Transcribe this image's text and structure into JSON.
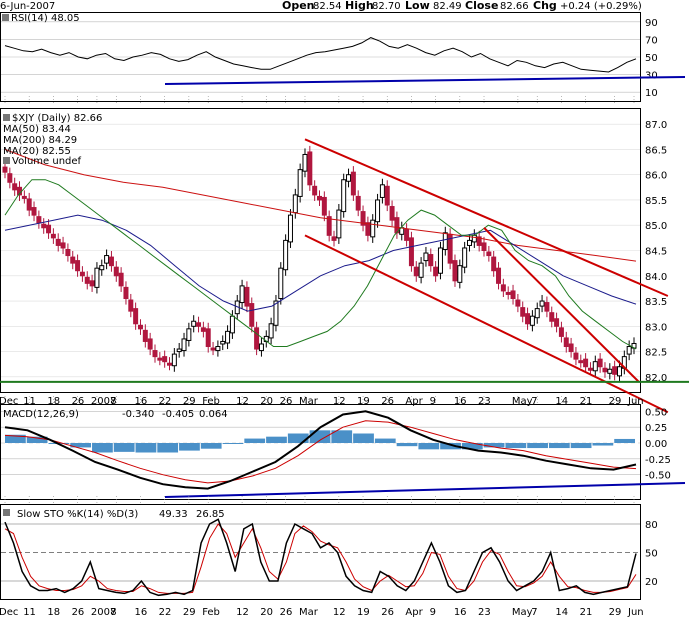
{
  "header": {
    "date": "6-Jun-2007",
    "open_label": "Open",
    "open": "82.54",
    "high_label": "High",
    "high": "82.70",
    "low_label": "Low",
    "low": "82.49",
    "close_label": "Close",
    "close": "82.66",
    "chg_label": "Chg",
    "chg": "+0.24 (+0.29%)"
  },
  "colors": {
    "up": "#000000",
    "down": "#b0173f",
    "ma50": "#1c1c8c",
    "ma200": "#cc1111",
    "ma20": "#1f7a1f",
    "trend": "#cc0000",
    "support": "#0000aa",
    "macd_hist": "#4a90c8",
    "sto_k": "#000000",
    "sto_d": "#cc0000",
    "grid": "#999999"
  },
  "chart_data": [
    {
      "panel": "rsi",
      "type": "line",
      "label": "RSI(14) 48.05",
      "ylim": [
        0,
        100
      ],
      "yticks": [
        10,
        30,
        50,
        70,
        90
      ],
      "values": [
        63,
        60,
        57,
        56,
        59,
        55,
        52,
        55,
        50,
        48,
        52,
        54,
        48,
        46,
        50,
        52,
        55,
        53,
        48,
        45,
        47,
        52,
        56,
        50,
        46,
        42,
        40,
        38,
        36,
        36,
        40,
        44,
        48,
        52,
        55,
        56,
        58,
        60,
        62,
        66,
        72,
        68,
        62,
        60,
        64,
        60,
        55,
        52,
        57,
        60,
        56,
        50,
        54,
        48,
        44,
        40,
        46,
        44,
        40,
        38,
        42,
        44,
        40,
        36,
        35,
        34,
        33,
        38,
        44,
        48
      ]
    },
    {
      "panel": "price",
      "type": "candlestick",
      "label": "$XJY (Daily) 82.66",
      "ylim": [
        81.7,
        87.3
      ],
      "yticks": [
        82.0,
        82.5,
        83.0,
        83.5,
        84.0,
        84.5,
        85.0,
        85.5,
        86.0,
        86.5,
        87.0
      ],
      "legend": [
        {
          "name": "MA(50) 83.44",
          "color": "#1c1c8c"
        },
        {
          "name": "MA(200) 84.29",
          "color": "#cc1111"
        },
        {
          "name": "MA(20) 82.55",
          "color": "#1f7a1f"
        },
        {
          "name": "Volume undef",
          "color": "#777777"
        }
      ],
      "x_ticks": [
        {
          "label": "Dec",
          "i": 0
        },
        {
          "label": "11",
          "i": 5
        },
        {
          "label": "18",
          "i": 10
        },
        {
          "label": "26",
          "i": 15
        },
        {
          "label": "2007",
          "i": 19
        },
        {
          "label": "8",
          "i": 23
        },
        {
          "label": "16",
          "i": 28
        },
        {
          "label": "22",
          "i": 33
        },
        {
          "label": "29",
          "i": 38
        },
        {
          "label": "Feb",
          "i": 42
        },
        {
          "label": "12",
          "i": 49
        },
        {
          "label": "20",
          "i": 54
        },
        {
          "label": "26",
          "i": 58
        },
        {
          "label": "Mar",
          "i": 62
        },
        {
          "label": "12",
          "i": 69
        },
        {
          "label": "19",
          "i": 74
        },
        {
          "label": "26",
          "i": 79
        },
        {
          "label": "Apr",
          "i": 84
        },
        {
          "label": "9",
          "i": 89
        },
        {
          "label": "16",
          "i": 94
        },
        {
          "label": "23",
          "i": 99
        },
        {
          "label": "May",
          "i": 106
        },
        {
          "label": "7",
          "i": 110
        },
        {
          "label": "14",
          "i": 115
        },
        {
          "label": "21",
          "i": 120
        },
        {
          "label": "29",
          "i": 126
        },
        {
          "label": "Jun",
          "i": 130
        }
      ],
      "close": [
        86.05,
        85.85,
        85.7,
        85.6,
        85.55,
        85.3,
        85.2,
        85.05,
        84.95,
        84.85,
        84.75,
        84.6,
        84.55,
        84.4,
        84.25,
        84.1,
        84.0,
        83.85,
        83.8,
        84.15,
        84.2,
        84.4,
        84.2,
        84.0,
        83.8,
        83.55,
        83.3,
        83.05,
        82.95,
        82.7,
        82.55,
        82.4,
        82.35,
        82.3,
        82.25,
        82.45,
        82.55,
        82.75,
        82.95,
        83.1,
        83.0,
        82.9,
        82.6,
        82.55,
        82.6,
        82.7,
        82.9,
        83.2,
        83.5,
        83.8,
        83.4,
        83.0,
        82.55,
        82.65,
        82.8,
        83.05,
        83.5,
        84.15,
        84.7,
        85.2,
        85.6,
        86.1,
        86.4,
        85.8,
        85.6,
        85.5,
        85.2,
        84.8,
        84.7,
        85.3,
        85.9,
        86.0,
        85.6,
        85.3,
        85.0,
        84.8,
        85.1,
        85.5,
        85.8,
        85.4,
        85.1,
        84.85,
        84.95,
        84.7,
        84.2,
        84.0,
        84.25,
        84.45,
        84.2,
        84.0,
        84.55,
        84.85,
        84.25,
        83.9,
        84.2,
        84.55,
        84.7,
        84.8,
        84.6,
        84.5,
        84.4,
        84.1,
        83.85,
        83.7,
        83.65,
        83.55,
        83.4,
        83.2,
        83.05,
        83.2,
        83.35,
        83.5,
        83.3,
        83.1,
        83.0,
        82.8,
        82.6,
        82.5,
        82.35,
        82.3,
        82.2,
        82.15,
        82.3,
        82.2,
        82.1,
        82.15,
        82.05,
        82.2,
        82.4,
        82.6,
        82.66
      ],
      "ma20": [
        85.2,
        85.6,
        85.9,
        85.9,
        85.8,
        85.6,
        85.4,
        85.2,
        85.0,
        84.8,
        84.6,
        84.4,
        84.2,
        84.0,
        83.8,
        83.6,
        83.4,
        83.2,
        83.0,
        82.8,
        82.6,
        82.6,
        82.7,
        82.8,
        82.9,
        83.1,
        83.4,
        83.8,
        84.3,
        84.8,
        85.1,
        85.3,
        85.2,
        85.0,
        84.8,
        84.8,
        85.0,
        84.9,
        84.5,
        84.3,
        84.2,
        84.0,
        83.6,
        83.3,
        83.1,
        82.9,
        82.7,
        82.55
      ],
      "ma50": [
        84.9,
        85.0,
        85.1,
        85.2,
        85.1,
        84.9,
        84.6,
        84.2,
        83.8,
        83.5,
        83.3,
        83.4,
        83.7,
        84.0,
        84.2,
        84.3,
        84.5,
        84.6,
        84.7,
        84.8,
        84.9,
        84.6,
        84.3,
        84.0,
        83.8,
        83.6,
        83.44
      ],
      "ma200": [
        86.5,
        86.2,
        86.0,
        85.85,
        85.75,
        85.6,
        85.45,
        85.3,
        85.15,
        85.05,
        84.95,
        84.85,
        84.75,
        84.6,
        84.5,
        84.4,
        84.29
      ],
      "trendlines": [
        {
          "from": [
            62,
            86.7
          ],
          "to": [
            137,
            83.6
          ]
        },
        {
          "from": [
            62,
            84.8
          ],
          "to": [
            137,
            81.3
          ]
        },
        {
          "from": [
            99,
            84.95
          ],
          "to": [
            131,
            81.9
          ]
        }
      ],
      "support": 81.9
    },
    {
      "panel": "macd",
      "type": "line",
      "label": "MACD(12,26,9)",
      "values_text": [
        "-0.340",
        "-0.405",
        "0.064"
      ],
      "ylim": [
        -0.9,
        0.6
      ],
      "yticks": [
        -0.5,
        -0.25,
        0.0,
        0.25,
        0.5
      ],
      "series": [
        {
          "name": "MACD",
          "values": [
            0.25,
            0.2,
            0.05,
            -0.12,
            -0.3,
            -0.42,
            -0.55,
            -0.65,
            -0.7,
            -0.72,
            -0.6,
            -0.45,
            -0.3,
            -0.05,
            0.25,
            0.45,
            0.5,
            0.4,
            0.2,
            0.05,
            -0.05,
            -0.12,
            -0.15,
            -0.2,
            -0.28,
            -0.34,
            -0.4,
            -0.42,
            -0.34
          ]
        },
        {
          "name": "Signal",
          "values": [
            0.12,
            0.1,
            0.05,
            -0.05,
            -0.15,
            -0.28,
            -0.4,
            -0.5,
            -0.58,
            -0.63,
            -0.6,
            -0.52,
            -0.4,
            -0.2,
            0.05,
            0.25,
            0.35,
            0.33,
            0.25,
            0.15,
            0.05,
            -0.02,
            -0.08,
            -0.12,
            -0.2,
            -0.26,
            -0.32,
            -0.38,
            -0.405
          ]
        }
      ],
      "histogram": [
        0.13,
        0.1,
        0.0,
        -0.07,
        -0.15,
        -0.14,
        -0.15,
        -0.15,
        -0.12,
        -0.09,
        0.0,
        0.07,
        0.1,
        0.15,
        0.2,
        0.2,
        0.15,
        0.07,
        -0.05,
        -0.1,
        -0.1,
        -0.1,
        -0.07,
        -0.08,
        -0.08,
        -0.08,
        -0.08,
        -0.04,
        0.064
      ]
    },
    {
      "panel": "sto",
      "type": "line",
      "label": "Slow STO %K(14) %D(3)",
      "values_text": [
        "49.33",
        "26.85"
      ],
      "ylim": [
        0,
        100
      ],
      "yticks": [
        20,
        50,
        80
      ],
      "series": [
        {
          "name": "%K",
          "values": [
            82,
            60,
            30,
            15,
            10,
            10,
            12,
            8,
            12,
            20,
            40,
            12,
            10,
            8,
            7,
            10,
            20,
            8,
            5,
            6,
            8,
            6,
            10,
            60,
            80,
            85,
            60,
            30,
            75,
            80,
            40,
            20,
            20,
            60,
            80,
            75,
            70,
            55,
            60,
            50,
            25,
            15,
            10,
            8,
            30,
            25,
            15,
            10,
            20,
            40,
            60,
            40,
            15,
            8,
            10,
            30,
            50,
            55,
            40,
            20,
            10,
            15,
            20,
            30,
            50,
            10,
            12,
            15,
            8,
            6,
            8,
            10,
            12,
            14,
            49
          ]
        },
        {
          "name": "%D",
          "values": [
            75,
            70,
            45,
            25,
            15,
            12,
            10,
            10,
            11,
            15,
            25,
            20,
            12,
            10,
            9,
            9,
            15,
            12,
            8,
            7,
            7,
            7,
            8,
            35,
            65,
            80,
            70,
            45,
            60,
            75,
            55,
            30,
            22,
            40,
            70,
            78,
            72,
            62,
            58,
            55,
            40,
            22,
            14,
            10,
            20,
            26,
            20,
            14,
            15,
            28,
            50,
            48,
            25,
            12,
            10,
            20,
            40,
            52,
            48,
            30,
            15,
            14,
            18,
            25,
            40,
            25,
            14,
            13,
            10,
            8,
            8,
            9,
            11,
            13,
            27
          ]
        }
      ]
    }
  ]
}
